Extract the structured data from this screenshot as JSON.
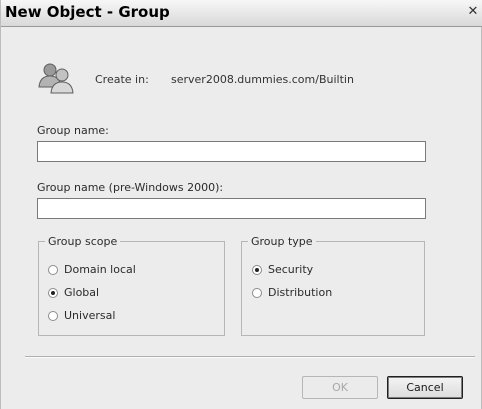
{
  "window": {
    "title": "New Object - Group",
    "close_glyph": "✕"
  },
  "header": {
    "icon": "group-users-icon",
    "create_in_label": "Create in:",
    "create_in_path": "server2008.dummies.com/Builtin"
  },
  "form": {
    "group_name_label": "Group name:",
    "group_name_value": "",
    "group_name_pre2000_label": "Group name (pre-Windows 2000):",
    "group_name_pre2000_value": ""
  },
  "group_scope": {
    "legend": "Group scope",
    "options": [
      {
        "label": "Domain local",
        "selected": false
      },
      {
        "label": "Global",
        "selected": true
      },
      {
        "label": "Universal",
        "selected": false
      }
    ]
  },
  "group_type": {
    "legend": "Group type",
    "options": [
      {
        "label": "Security",
        "selected": true
      },
      {
        "label": "Distribution",
        "selected": false
      }
    ]
  },
  "buttons": {
    "ok_label": "OK",
    "ok_enabled": false,
    "cancel_label": "Cancel"
  }
}
